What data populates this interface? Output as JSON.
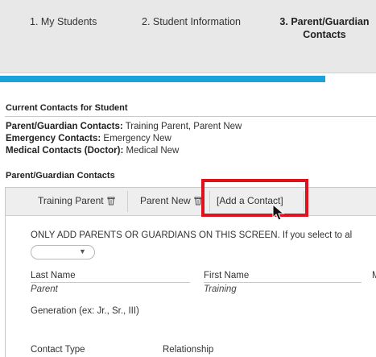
{
  "wizard": {
    "steps": [
      {
        "label": "1. My Students"
      },
      {
        "label": "2. Student Information"
      },
      {
        "label_line1": "3. Parent/Guardian",
        "label_line2": "Contacts"
      }
    ],
    "progress_fraction": 0.865
  },
  "current_contacts": {
    "heading": "Current Contacts for Student",
    "rows": [
      {
        "label": "Parent/Guardian Contacts:",
        "value": " Training Parent, Parent New"
      },
      {
        "label": "Emergency Contacts:",
        "value": " Emergency New"
      },
      {
        "label": "Medical Contacts (Doctor):",
        "value": " Medical New"
      }
    ]
  },
  "pg_section": {
    "heading": "Parent/Guardian Contacts",
    "tabs": [
      {
        "label": "Training Parent",
        "icon": "trash-icon"
      },
      {
        "label": "Parent New",
        "icon": "trash-icon"
      },
      {
        "label": "[Add a Contact]"
      }
    ]
  },
  "form": {
    "notice": "ONLY ADD PARENTS OR GUARDIANS ON THIS SCREEN. If you select to al",
    "last_name_label": "Last Name",
    "last_name_value": "Parent",
    "first_name_label": "First Name",
    "first_name_value": "Training",
    "middle_label": "M",
    "generation_label": "Generation (ex: Jr., Sr., III)",
    "contact_type_label": "Contact Type",
    "relationship_label": "Relationship"
  },
  "colors": {
    "progress": "#19a2dc",
    "highlight": "#e0101d"
  }
}
